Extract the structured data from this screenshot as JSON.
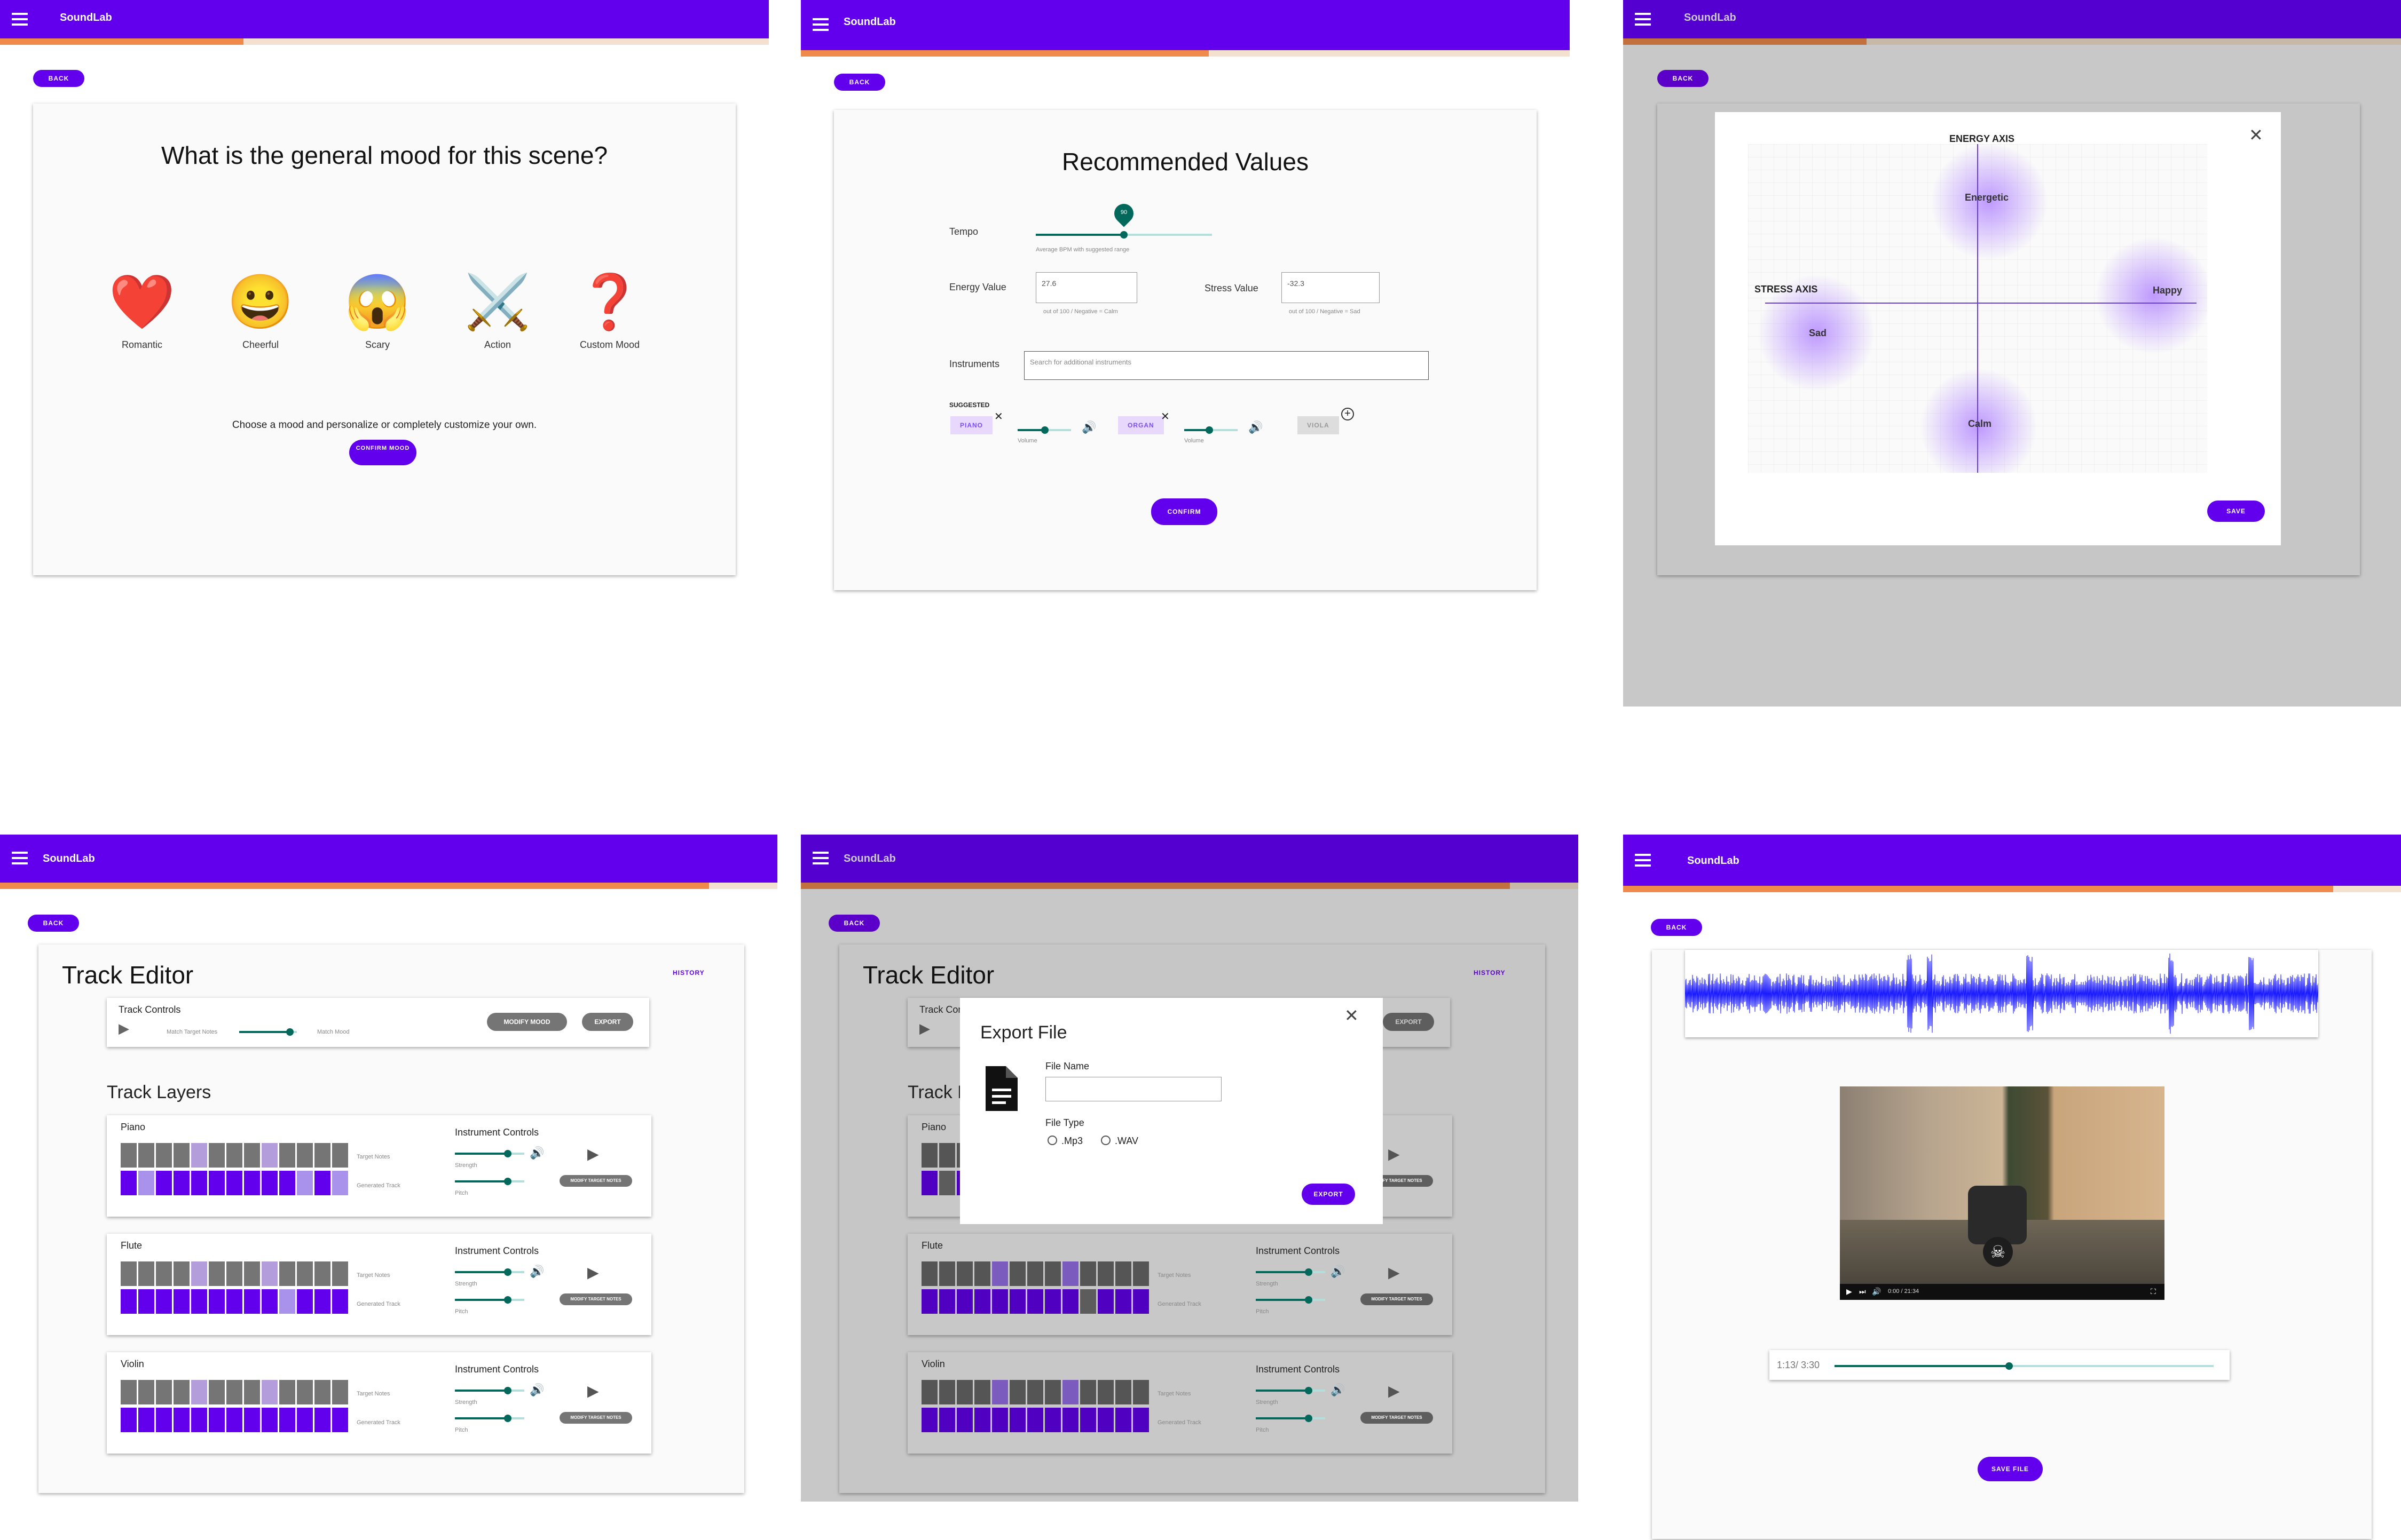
{
  "app": {
    "title": "SoundLab",
    "back_label": "BACK"
  },
  "colors": {
    "primary": "#6200ee",
    "accent_orange": "#f08a4b",
    "teal": "#00695c",
    "lavender": "#ad8bf0"
  },
  "screen1": {
    "question": "What is the general mood for this scene?",
    "moods": [
      {
        "label": "Romantic",
        "icon": "heart-icon",
        "glyph": "❤️"
      },
      {
        "label": "Cheerful",
        "icon": "grinning-face-icon",
        "glyph": "😀"
      },
      {
        "label": "Scary",
        "icon": "scream-face-icon",
        "glyph": "😱"
      },
      {
        "label": "Action",
        "icon": "crossed-swords-icon",
        "glyph": "⚔️"
      },
      {
        "label": "Custom Mood",
        "icon": "question-mark-icon",
        "glyph": "❓"
      }
    ],
    "hint": "Choose a mood and personalize or completely customize your own.",
    "confirm_label": "CONFIRM MOOD",
    "progress": 0.32
  },
  "screen2": {
    "title": "Recommended Values",
    "tempo_label": "Tempo",
    "tempo_value": "90",
    "tempo_hint": "Average BPM with suggested range",
    "energy_label": "Energy Value",
    "energy_value": "27.6",
    "energy_hint": "out of 100 / Negative = Calm",
    "stress_label": "Stress Value",
    "stress_value": "-32.3",
    "stress_hint": "out of 100 / Negative = Sad",
    "instruments_label": "Instruments",
    "instruments_placeholder": "Search for additional instruments",
    "suggested_label": "SUGGESTED",
    "chips": [
      {
        "name": "PIANO",
        "volume_label": "Volume",
        "volume": 0.5
      },
      {
        "name": "ORGAN",
        "volume_label": "Volume",
        "volume": 0.45
      }
    ],
    "extra_chip": "VIOLA",
    "confirm_label": "CONFIRM",
    "progress": 0.53
  },
  "screen3": {
    "energy_axis": "ENERGY AXIS",
    "stress_axis": "STRESS AXIS",
    "moods": [
      "Energetic",
      "Happy",
      "Sad",
      "Calm"
    ],
    "save_label": "SAVE",
    "progress": 0.32
  },
  "screen4": {
    "title": "Track Editor",
    "history_label": "HISTORY",
    "controls_title": "Track Controls",
    "match_target": "Match Target Notes",
    "match_mood": "Match Mood",
    "modify_mood": "MODIFY MOOD",
    "export": "EXPORT",
    "layers_title": "Track Layers",
    "layers": [
      {
        "name": "Piano",
        "target": [
          0,
          0,
          0,
          0,
          1,
          0,
          0,
          0,
          1,
          0,
          0,
          0,
          0
        ],
        "generated": [
          1,
          0,
          1,
          1,
          1,
          1,
          1,
          1,
          1,
          1,
          0,
          1,
          0
        ]
      },
      {
        "name": "Flute",
        "target": [
          0,
          0,
          0,
          0,
          1,
          0,
          0,
          0,
          1,
          0,
          0,
          0,
          0
        ],
        "generated": [
          1,
          1,
          1,
          1,
          1,
          1,
          1,
          1,
          1,
          0,
          1,
          1,
          1
        ]
      },
      {
        "name": "Violin",
        "target": [
          0,
          0,
          0,
          0,
          1,
          0,
          0,
          0,
          1,
          0,
          0,
          0,
          0
        ],
        "generated": [
          1,
          1,
          1,
          1,
          1,
          1,
          1,
          1,
          1,
          1,
          1,
          1,
          1
        ]
      }
    ],
    "target_notes": "Target Notes",
    "generated_track": "Generated Track",
    "instrument_controls": "Instrument Controls",
    "strength": "Strength",
    "pitch": "Pitch",
    "modify_target": "MODIFY TARGET NOTES",
    "progress": 0.91
  },
  "screen5": {
    "dialog_title": "Export File",
    "file_name_label": "File Name",
    "file_type_label": "File Type",
    "options": [
      ".Mp3",
      ".WAV"
    ],
    "export_label": "EXPORT",
    "progress": 0.91
  },
  "screen6": {
    "time": "1:13/ 3:30",
    "video_time": "0:00 / 21:34",
    "save_label": "SAVE FILE",
    "progress": 0.91,
    "scrub": 0.46
  }
}
